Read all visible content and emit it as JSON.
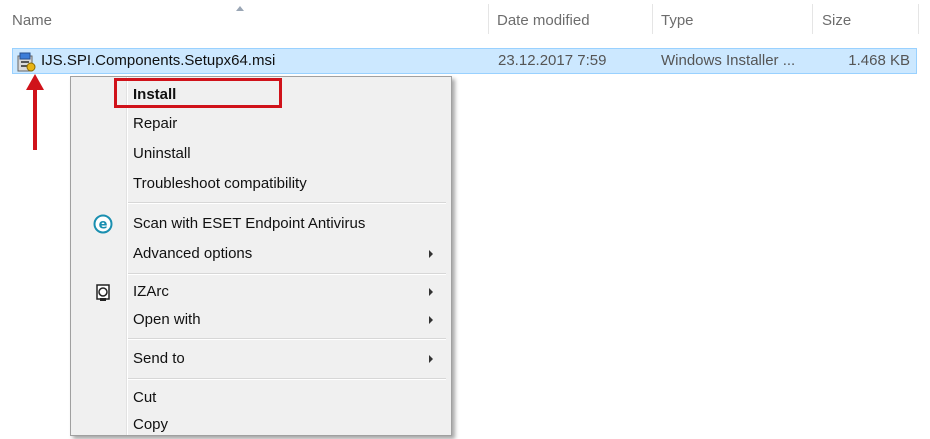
{
  "columns": {
    "name": "Name",
    "date_modified": "Date modified",
    "type": "Type",
    "size": "Size"
  },
  "file": {
    "name": "IJS.SPI.Components.Setupx64.msi",
    "date_modified": "23.12.2017 7:59",
    "type": "Windows Installer ...",
    "size": "1.468 KB",
    "icon": "msi-installer-icon"
  },
  "context_menu": {
    "items": [
      {
        "label": "Install",
        "bold": true,
        "submenu": false
      },
      {
        "label": "Repair",
        "submenu": false
      },
      {
        "label": "Uninstall",
        "submenu": false
      },
      {
        "label": "Troubleshoot compatibility",
        "submenu": false
      },
      {
        "label": "Scan with ESET Endpoint Antivirus",
        "icon": "eset-icon",
        "submenu": false
      },
      {
        "label": "Advanced options",
        "submenu": true
      },
      {
        "label": "IZArc",
        "icon": "izarc-icon",
        "submenu": true
      },
      {
        "label": "Open with",
        "submenu": true
      },
      {
        "label": "Send to",
        "submenu": true
      },
      {
        "label": "Cut",
        "submenu": false
      },
      {
        "label": "Copy",
        "submenu": false
      }
    ]
  },
  "colors": {
    "selection_bg": "#cce8ff",
    "selection_border": "#99d1ff",
    "menu_bg": "#f0f0f0",
    "annotation_red": "#d0121a"
  }
}
